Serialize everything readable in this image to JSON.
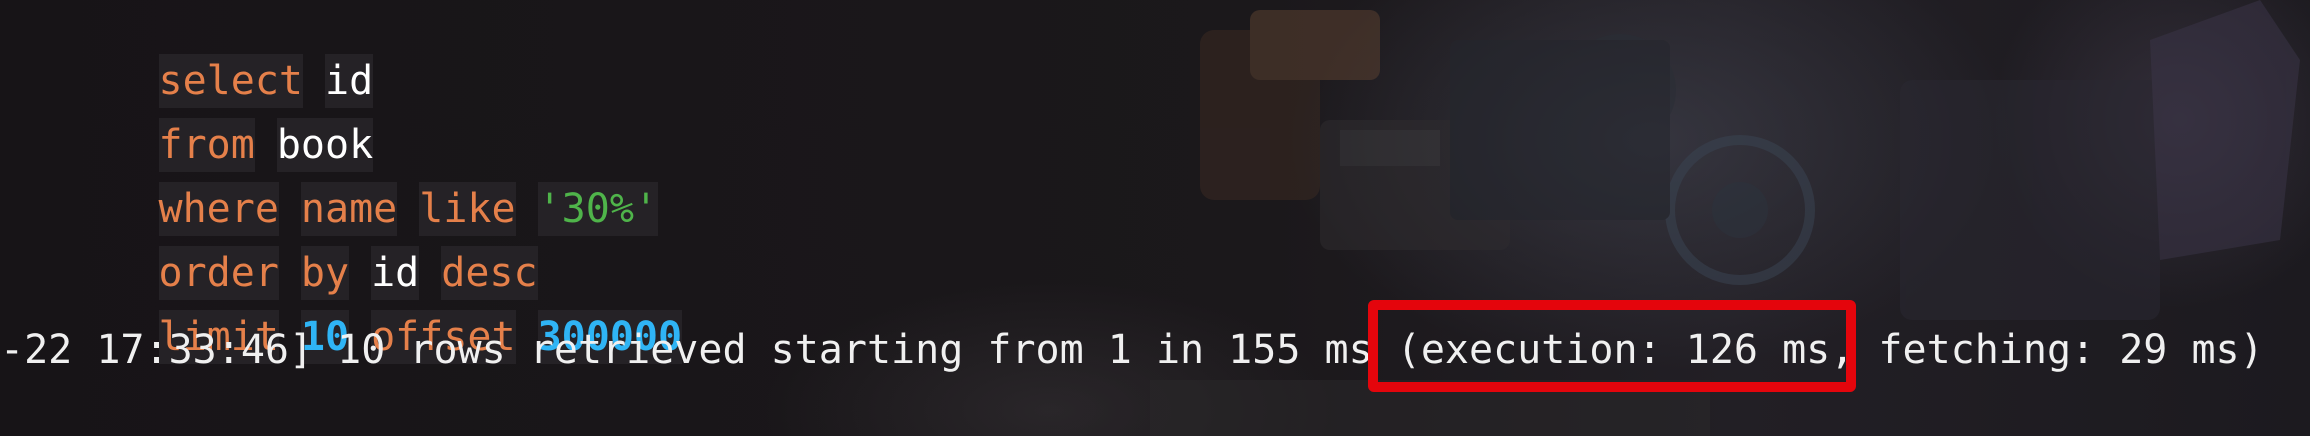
{
  "editor": {
    "lines": [
      [
        {
          "t": "select",
          "k": "kw"
        },
        {
          "t": "id",
          "k": "id"
        }
      ],
      [
        {
          "t": "from",
          "k": "kw"
        },
        {
          "t": "book",
          "k": "id"
        }
      ],
      [
        {
          "t": "where",
          "k": "kw"
        },
        {
          "t": "name",
          "k": "kw"
        },
        {
          "t": "like",
          "k": "kw"
        },
        {
          "t": "'30%'",
          "k": "str"
        }
      ],
      [
        {
          "t": "order",
          "k": "kw"
        },
        {
          "t": "by",
          "k": "kw"
        },
        {
          "t": "id",
          "k": "id"
        },
        {
          "t": "desc",
          "k": "kw"
        }
      ],
      [
        {
          "t": "limit",
          "k": "kw"
        },
        {
          "t": "10",
          "k": "num"
        },
        {
          "t": "offset",
          "k": "kw"
        },
        {
          "t": "300000",
          "k": "num"
        }
      ]
    ]
  },
  "console": {
    "status_line": "-22 17:33:46] 10 rows retrieved starting from 1 in 155 ms (execution: 126 ms, fetching: 29 ms)"
  },
  "colors": {
    "keyword": "#e5804a",
    "identifier": "#ffffff",
    "string": "#4fb44a",
    "number": "#2fb4f5",
    "highlight_box": "#e4050c"
  }
}
